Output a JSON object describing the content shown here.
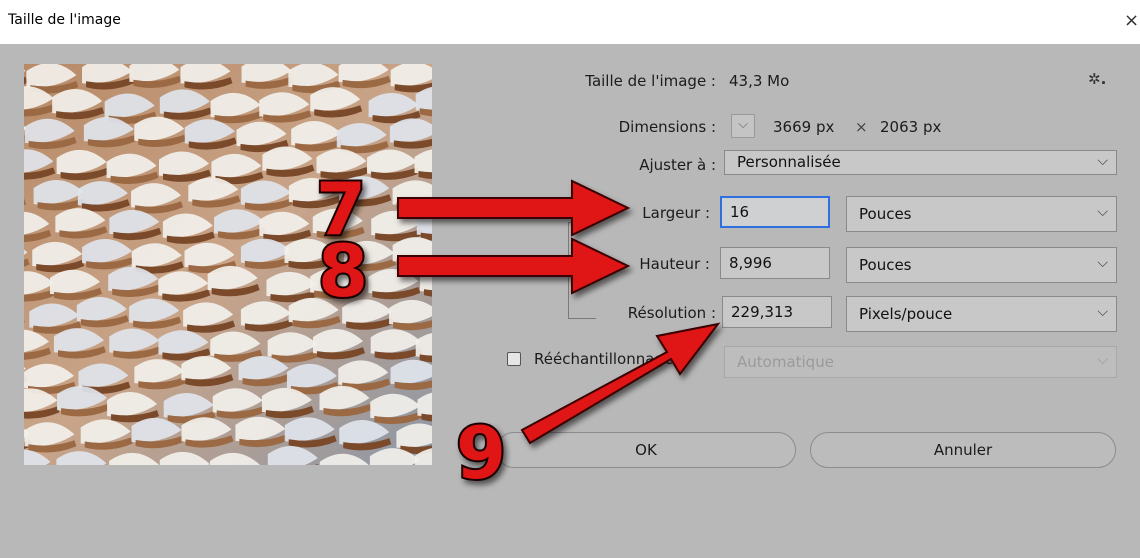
{
  "window": {
    "title": "Taille de l'image",
    "close_glyph": "×"
  },
  "image_size": {
    "label": "Taille de l'image :",
    "value": "43,3 Mo",
    "settings_icon": "gear-icon",
    "settings_glyph": "✲."
  },
  "dimensions": {
    "label": "Dimensions :",
    "chevron_icon": "chevron-down-icon",
    "width_value": "3669 px",
    "times": "×",
    "height_value": "2063 px"
  },
  "fit_to": {
    "label": "Ajuster à :",
    "selected": "Personnalisée"
  },
  "width": {
    "label": "Largeur :",
    "value": "16",
    "unit": "Pouces"
  },
  "height": {
    "label": "Hauteur :",
    "value": "8,996",
    "unit": "Pouces"
  },
  "resolution": {
    "label": "Résolution :",
    "value": "229,313",
    "unit": "Pixels/pouce"
  },
  "resample": {
    "label": "Rééchantillonnage :",
    "checked": false,
    "method": "Automatique"
  },
  "buttons": {
    "ok": "OK",
    "cancel": "Annuler"
  },
  "annotations": {
    "step7": "7",
    "step8": "8",
    "step9": "9",
    "arrow_color": "#e01212"
  },
  "dropdown_chevron": "⌵",
  "colors": {
    "dialog_bg": "#b8b8b8",
    "focus_border": "#2f6fe0"
  }
}
